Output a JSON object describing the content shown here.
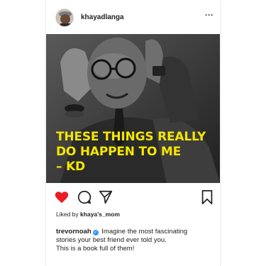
{
  "post": {
    "username": "khayadlanga",
    "more_glyph": "···",
    "overlay_lines": [
      "THESE THINGS REALLY",
      "DO HAPPEN TO ME",
      "– KD"
    ],
    "overlay_color": "#f5e600",
    "like_color": "#ed1c24"
  },
  "likes": {
    "prefix": "Liked by",
    "user": "khaya's_mom"
  },
  "comment": {
    "user": "trevornoah",
    "verified_glyph": "✓",
    "line1": "Imagine the most fascinating",
    "line2": "stories your best friend ever told you.",
    "line3": "This is a book full of them!"
  },
  "icons": {
    "like": "heart-icon",
    "comment": "comment-icon",
    "share": "send-icon",
    "save": "bookmark-icon",
    "more": "more-options-icon"
  }
}
